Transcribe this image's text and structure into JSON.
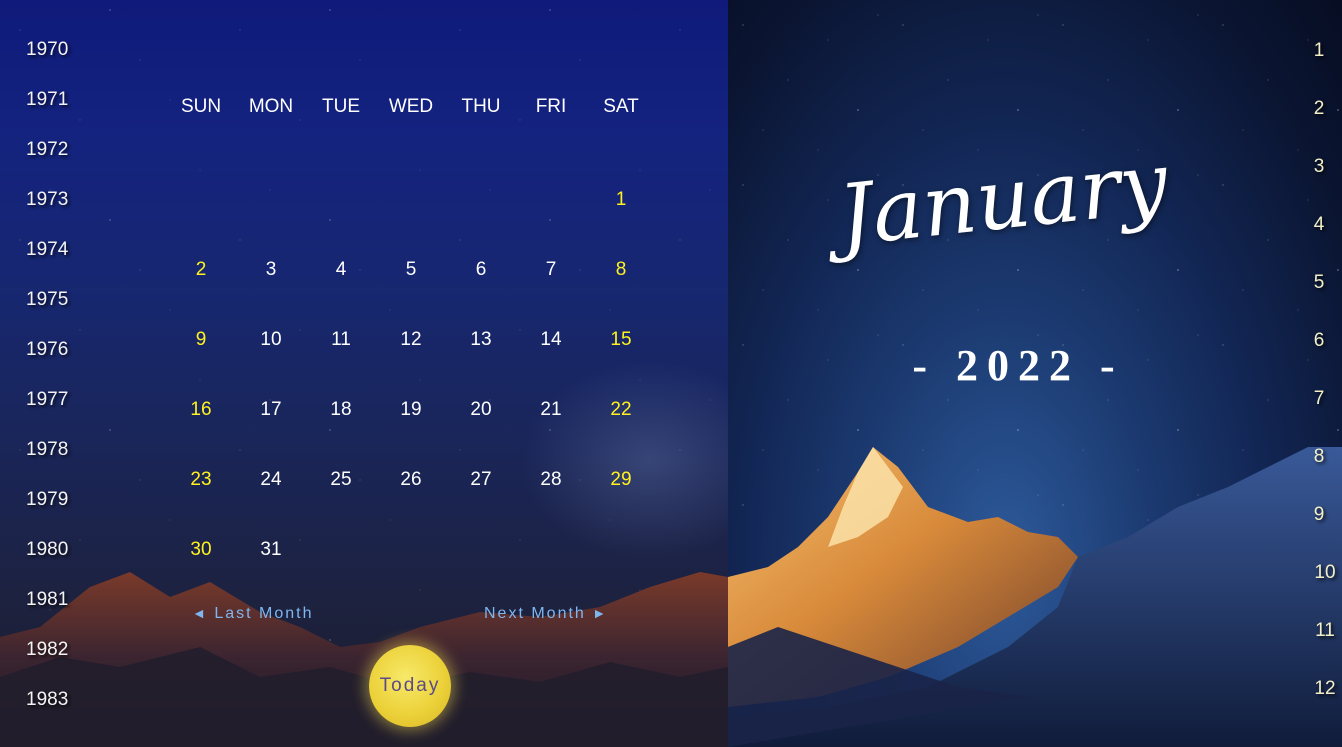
{
  "years": [
    "1970",
    "1971",
    "1972",
    "1973",
    "1974",
    "1975",
    "1976",
    "1977",
    "1978",
    "1979",
    "1980",
    "1981",
    "1982",
    "1983"
  ],
  "weekdays": [
    "SUN",
    "MON",
    "TUE",
    "WED",
    "THU",
    "FRI",
    "SAT"
  ],
  "calendar": {
    "weeks": [
      [
        "",
        "",
        "",
        "",
        "",
        "",
        "1"
      ],
      [
        "2",
        "3",
        "4",
        "5",
        "6",
        "7",
        "8"
      ],
      [
        "9",
        "10",
        "11",
        "12",
        "13",
        "14",
        "15"
      ],
      [
        "16",
        "17",
        "18",
        "19",
        "20",
        "21",
        "22"
      ],
      [
        "23",
        "24",
        "25",
        "26",
        "27",
        "28",
        "29"
      ],
      [
        "30",
        "31",
        "",
        "",
        "",
        "",
        ""
      ]
    ],
    "weekend_color": "#fff21f",
    "weekday_color": "#ffffff"
  },
  "nav": {
    "prev_arrow": "◄",
    "prev_label": "Last Month",
    "next_label": "Next Month",
    "next_arrow": "►"
  },
  "today_label": "Today",
  "header": {
    "month_name": "January",
    "year_text": "- 2022 -"
  },
  "months": [
    "1",
    "2",
    "3",
    "4",
    "5",
    "6",
    "7",
    "8",
    "9",
    "10",
    "11",
    "12"
  ],
  "colors": {
    "nav_link": "#7fb6f0",
    "today_button": "#ecd23a",
    "today_text": "#5a4a8a",
    "month_number": "#f3f0c8"
  }
}
